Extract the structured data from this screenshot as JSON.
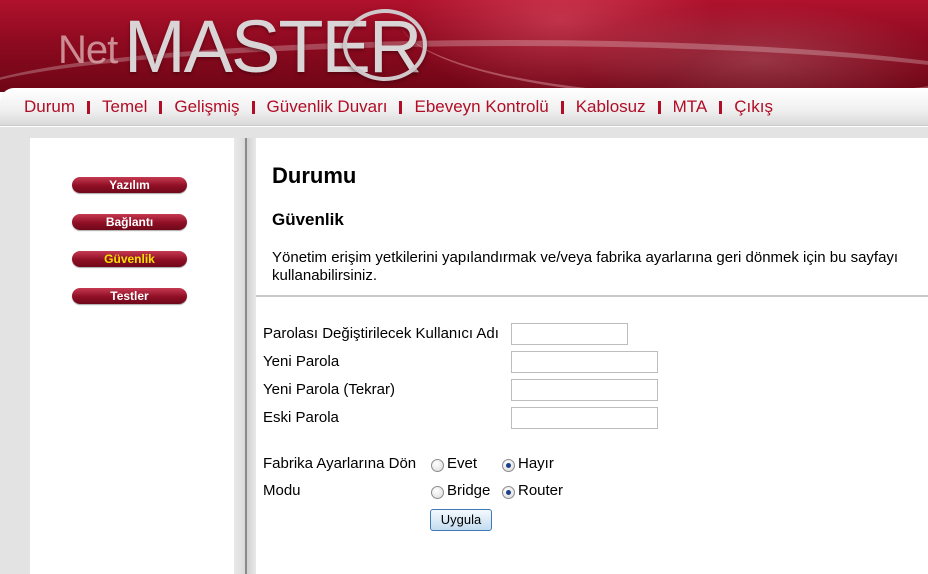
{
  "header": {
    "logo_net": "Net",
    "logo_master": "MASTER"
  },
  "nav": {
    "items": [
      "Durum",
      "Temel",
      "Gelişmiş",
      "Güvenlik Duvarı",
      "Ebeveyn Kontrolü",
      "Kablosuz",
      "MTA",
      "Çıkış"
    ]
  },
  "sidebar": {
    "items": [
      {
        "label": "Yazılım",
        "active": false
      },
      {
        "label": "Bağlantı",
        "active": false
      },
      {
        "label": "Güvenlik",
        "active": true
      },
      {
        "label": "Testler",
        "active": false
      }
    ]
  },
  "main": {
    "title": "Durumu",
    "section_title": "Güvenlik",
    "description": "Yönetim erişim yetkilerini yapılandırmak ve/veya fabrika ayarlarına geri dönmek için bu sayfayı kullanabilirsiniz."
  },
  "form": {
    "username_label": "Parolası Değiştirilecek Kullanıcı Adı",
    "username_value": "",
    "new_password_label": "Yeni Parola",
    "new_password_value": "",
    "confirm_password_label": "Yeni Parola (Tekrar)",
    "confirm_password_value": "",
    "old_password_label": "Eski Parola",
    "old_password_value": "",
    "factory_reset_label": "Fabrika Ayarlarına Dön",
    "factory_reset_yes": "Evet",
    "factory_reset_no": "Hayır",
    "factory_reset_selected": "Hayır",
    "mode_label": "Modu",
    "mode_bridge": "Bridge",
    "mode_router": "Router",
    "mode_selected": "Router",
    "apply_label": "Uygula"
  },
  "colors": {
    "brand_red": "#b00d26",
    "active_sidebar_text": "#f4e200"
  }
}
